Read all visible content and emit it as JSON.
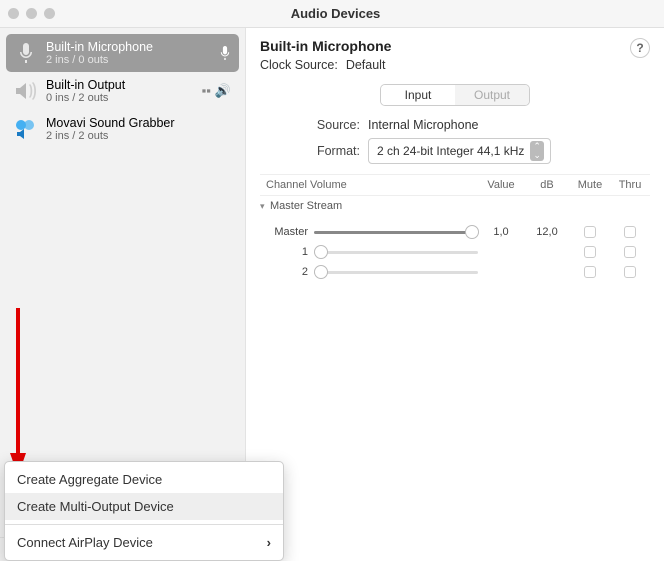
{
  "window": {
    "title": "Audio Devices"
  },
  "sidebar": {
    "devices": [
      {
        "name": "Built-in Microphone",
        "sub": "2 ins / 0 outs",
        "selected": true
      },
      {
        "name": "Built-in Output",
        "sub": "0 ins / 2 outs",
        "selected": false
      },
      {
        "name": "Movavi Sound Grabber",
        "sub": "2 ins / 2 outs",
        "selected": false
      }
    ]
  },
  "menu": {
    "aggregate": "Create Aggregate Device",
    "multi": "Create Multi-Output Device",
    "airplay": "Connect AirPlay Device"
  },
  "detail": {
    "title": "Built-in Microphone",
    "clock_label": "Clock Source:",
    "clock_value": "Default",
    "tab_input": "Input",
    "tab_output": "Output",
    "source_label": "Source:",
    "source_value": "Internal Microphone",
    "format_label": "Format:",
    "format_value": "2 ch 24-bit Integer 44,1 kHz",
    "cols": {
      "ch": "Channel Volume",
      "val": "Value",
      "db": "dB",
      "mute": "Mute",
      "thru": "Thru"
    },
    "stream": "Master Stream",
    "channels": [
      {
        "label": "Master",
        "value": "1,0",
        "db": "12,0",
        "pos": 0.92,
        "filled": true
      },
      {
        "label": "1",
        "value": "",
        "db": "",
        "pos": 0.0,
        "filled": false
      },
      {
        "label": "2",
        "value": "",
        "db": "",
        "pos": 0.0,
        "filled": false
      }
    ]
  }
}
